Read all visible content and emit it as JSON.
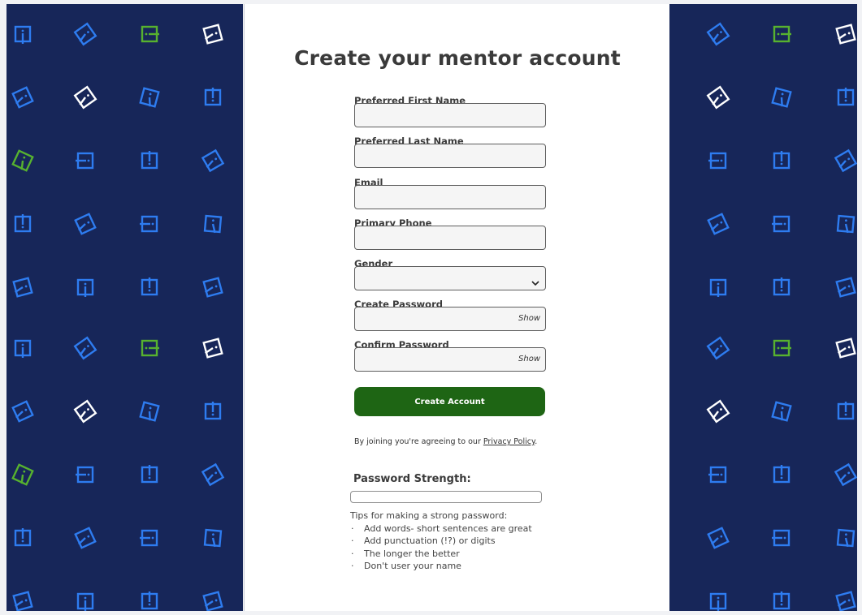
{
  "page": {
    "title": "Create your mentor account"
  },
  "form": {
    "fields": [
      {
        "label": "Preferred First Name",
        "value": "",
        "type": "text"
      },
      {
        "label": "Preferred Last Name",
        "value": "",
        "type": "text"
      },
      {
        "label": "Email",
        "value": "",
        "type": "email"
      },
      {
        "label": "Primary Phone",
        "value": "",
        "type": "tel"
      },
      {
        "label": "Gender",
        "value": "",
        "type": "select"
      },
      {
        "label": "Create Password",
        "value": "",
        "type": "password",
        "toggle": "Show"
      },
      {
        "label": "Confirm Password",
        "value": "",
        "type": "password",
        "toggle": "Show"
      }
    ],
    "submit_label": "Create Account"
  },
  "legal": {
    "text": "By joining you're agreeing to our ",
    "link": "Privacy Policy",
    "suffix": "."
  },
  "strength": {
    "title": "Password Strength:",
    "level": 0,
    "tips_heading": "Tips for making a strong password:",
    "tips": [
      "Add words- short sentences are great",
      "Add punctuation (!?) or digits",
      "The longer the better",
      "Don't user your name"
    ]
  },
  "colors": {
    "panel_bg": "#172659",
    "icon_blue": "#2e7cf0",
    "icon_green": "#57b22f",
    "icon_white": "#ffffff",
    "button": "#1e6514"
  }
}
